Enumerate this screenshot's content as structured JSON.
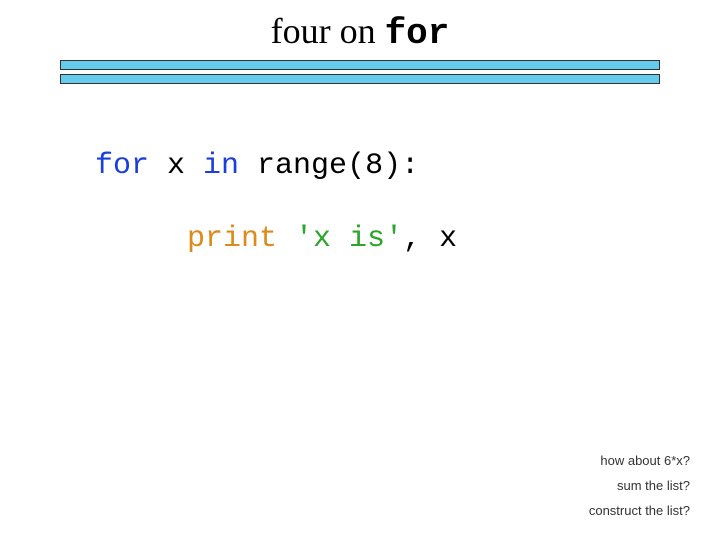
{
  "title": {
    "part1": "four on ",
    "part2": "for"
  },
  "code": {
    "line1": {
      "for": "for",
      "mid": " x ",
      "in": "in",
      "rest": " range(8):"
    },
    "line2": {
      "print": "print",
      "sp1": " ",
      "str": "'x is'",
      "rest": ", x"
    }
  },
  "footer": {
    "q1": "how about 6*x?",
    "q2": "sum the list?",
    "q3": "construct the list?"
  },
  "chart_data": {
    "type": "table",
    "title": "four on for",
    "code_lines": [
      "for x in range(8):",
      "    print 'x is', x"
    ],
    "questions": [
      "how about 6*x?",
      "sum the list?",
      "construct the list?"
    ]
  }
}
